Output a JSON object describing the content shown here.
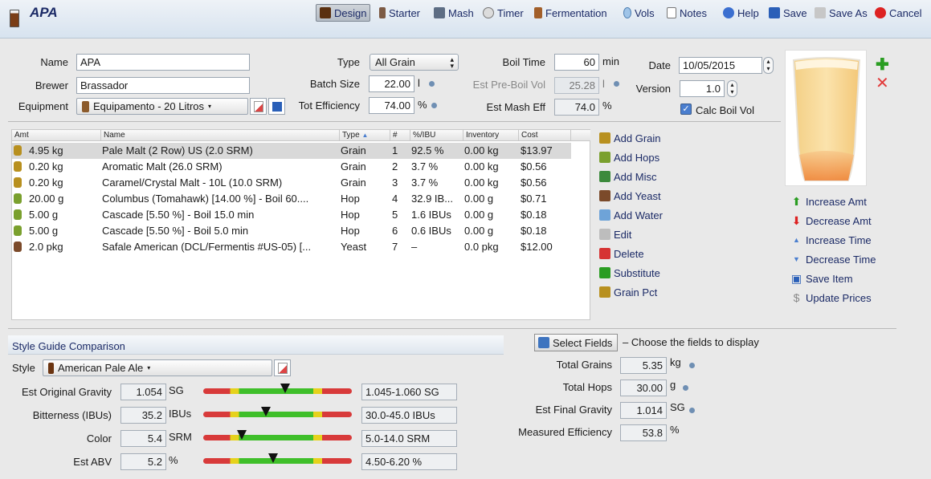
{
  "app": {
    "title": "APA"
  },
  "toolbar": {
    "design": "Design",
    "starter": "Starter",
    "mash": "Mash",
    "timer": "Timer",
    "fermentation": "Fermentation",
    "vols": "Vols",
    "notes": "Notes",
    "help": "Help",
    "save": "Save",
    "save_as": "Save As",
    "cancel": "Cancel"
  },
  "recipe": {
    "name_label": "Name",
    "name_value": "APA",
    "brewer_label": "Brewer",
    "brewer_value": "Brassador",
    "equipment_label": "Equipment",
    "equipment_value": "Equipamento - 20 Litros",
    "type_label": "Type",
    "type_value": "All Grain",
    "batch_label": "Batch Size",
    "batch_value": "22.00",
    "batch_unit": "l",
    "eff_label": "Tot Efficiency",
    "eff_value": "74.00",
    "eff_unit": "%",
    "boil_label": "Boil Time",
    "boil_value": "60",
    "boil_unit": "min",
    "preboil_label": "Est Pre-Boil Vol",
    "preboil_value": "25.28",
    "preboil_unit": "l",
    "mash_eff_label": "Est Mash Eff",
    "mash_eff_value": "74.0",
    "mash_eff_unit": "%",
    "date_label": "Date",
    "date_value": "10/05/2015",
    "version_label": "Version",
    "version_value": "1.0",
    "calc_boil_label": "Calc Boil Vol"
  },
  "ingredients": {
    "columns": [
      "Amt",
      "Name",
      "Type",
      "#",
      "%/IBU",
      "Inventory",
      "Cost"
    ],
    "rows": [
      {
        "amt": "4.95 kg",
        "name": "Pale Malt (2 Row) US (2.0 SRM)",
        "type": "Grain",
        "num": "1",
        "pct": "92.5 %",
        "inv": "0.00 kg",
        "cost": "$13.97",
        "icon": "grain-icon"
      },
      {
        "amt": "0.20 kg",
        "name": "Aromatic Malt (26.0 SRM)",
        "type": "Grain",
        "num": "2",
        "pct": "3.7 %",
        "inv": "0.00 kg",
        "cost": "$0.56",
        "icon": "grain-icon"
      },
      {
        "amt": "0.20 kg",
        "name": "Caramel/Crystal Malt - 10L (10.0 SRM)",
        "type": "Grain",
        "num": "3",
        "pct": "3.7 %",
        "inv": "0.00 kg",
        "cost": "$0.56",
        "icon": "grain-icon"
      },
      {
        "amt": "20.00 g",
        "name": "Columbus (Tomahawk) [14.00 %] - Boil 60....",
        "type": "Hop",
        "num": "4",
        "pct": "32.9 IB...",
        "inv": "0.00 g",
        "cost": "$0.71",
        "icon": "hop-icon"
      },
      {
        "amt": "5.00 g",
        "name": "Cascade [5.50 %] - Boil 15.0 min",
        "type": "Hop",
        "num": "5",
        "pct": "1.6 IBUs",
        "inv": "0.00 g",
        "cost": "$0.18",
        "icon": "hop-icon"
      },
      {
        "amt": "5.00 g",
        "name": "Cascade [5.50 %] - Boil 5.0 min",
        "type": "Hop",
        "num": "6",
        "pct": "0.6 IBUs",
        "inv": "0.00 g",
        "cost": "$0.18",
        "icon": "hop-icon"
      },
      {
        "amt": "2.0 pkg",
        "name": "Safale American  (DCL/Fermentis #US-05) [...",
        "type": "Yeast",
        "num": "7",
        "pct": "–",
        "inv": "0.0 pkg",
        "cost": "$12.00",
        "icon": "yeast-icon"
      }
    ]
  },
  "actions": [
    "Add Grain",
    "Add Hops",
    "Add Misc",
    "Add Yeast",
    "Add Water",
    "Edit",
    "Delete",
    "Substitute",
    "Grain Pct"
  ],
  "right_actions": [
    "Increase Amt",
    "Decrease Amt",
    "Increase Time",
    "Decrease Time",
    "Save Item",
    "Update Prices"
  ],
  "style": {
    "section_title": "Style Guide Comparison",
    "style_label": "Style",
    "style_value": "American Pale Ale",
    "rows": [
      {
        "label": "Est Original Gravity",
        "value": "1.054",
        "unit": "SG",
        "range": "1.045-1.060 SG",
        "marker": 0.55
      },
      {
        "label": "Bitterness (IBUs)",
        "value": "35.2",
        "unit": "IBUs",
        "range": "30.0-45.0 IBUs",
        "marker": 0.42
      },
      {
        "label": "Color",
        "value": "5.4",
        "unit": "SRM",
        "range": "5.0-14.0 SRM",
        "marker": 0.26
      },
      {
        "label": "Est ABV",
        "value": "5.2",
        "unit": "%",
        "range": "4.50-6.20 %",
        "marker": 0.47
      }
    ]
  },
  "fields": {
    "select_button": "Select Fields",
    "hint": "– Choose the fields to display",
    "rows": [
      {
        "label": "Total Grains",
        "value": "5.35",
        "unit": "kg"
      },
      {
        "label": "Total Hops",
        "value": "30.00",
        "unit": "g"
      },
      {
        "label": "Est Final Gravity",
        "value": "1.014",
        "unit": "SG"
      },
      {
        "label": "Measured Efficiency",
        "value": "53.8",
        "unit": "%"
      }
    ]
  },
  "colors": {
    "accent": "#1b2a66",
    "bar_red": "#d83a3a",
    "bar_yellow": "#e6d21c",
    "bar_green": "#3fbf2a"
  }
}
